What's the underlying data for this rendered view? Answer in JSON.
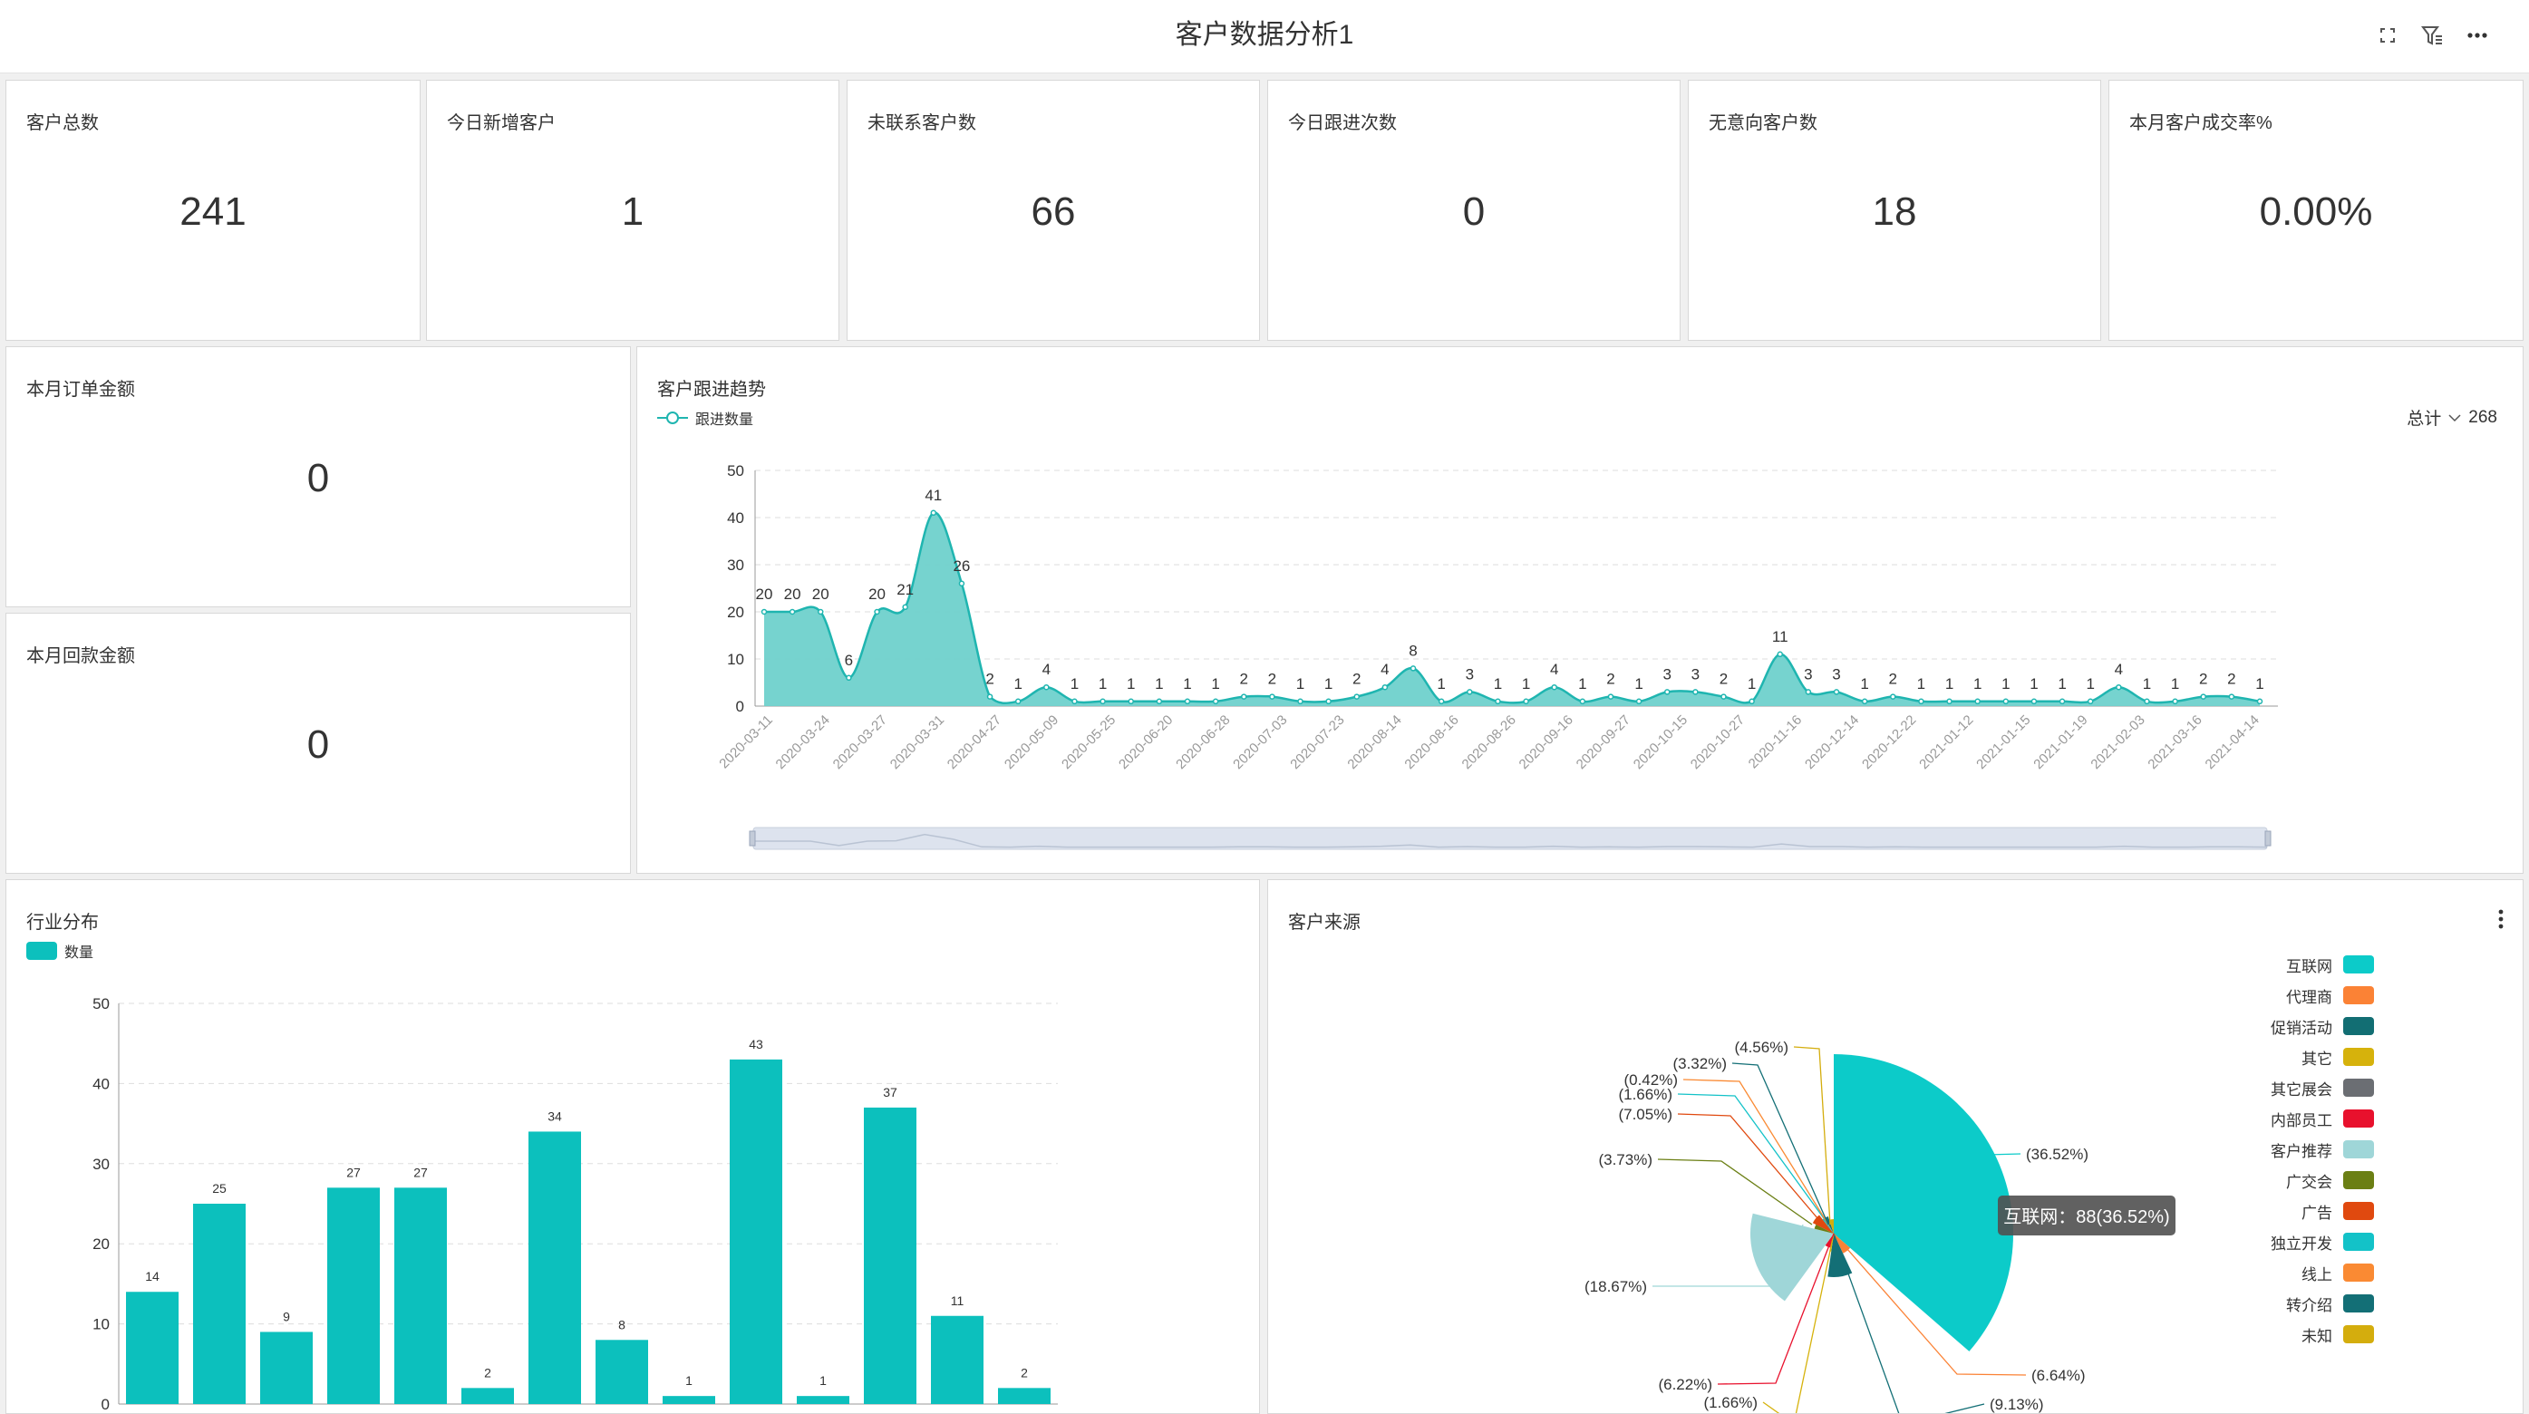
{
  "header": {
    "title": "客户数据分析1",
    "tools": [
      "expand-icon",
      "filter-icon",
      "more-icon"
    ]
  },
  "kpis": [
    {
      "label": "客户总数",
      "value": "241"
    },
    {
      "label": "今日新增客户",
      "value": "1"
    },
    {
      "label": "未联系客户数",
      "value": "66"
    },
    {
      "label": "今日跟进次数",
      "value": "0"
    },
    {
      "label": "无意向客户数",
      "value": "18"
    },
    {
      "label": "本月客户成交率%",
      "value": "0.00%"
    }
  ],
  "order_amount": {
    "label": "本月订单金额",
    "value": "0"
  },
  "payment_amount": {
    "label": "本月回款金额",
    "value": "0"
  },
  "trend": {
    "title": "客户跟进趋势",
    "legend": "跟进数量",
    "total_label": "总计",
    "total_value": "268"
  },
  "industry": {
    "title": "行业分布",
    "legend": "数量"
  },
  "source": {
    "title": "客户来源",
    "tooltip": "互联网：88(36.52%)"
  },
  "colors": {
    "teal": "#0cc0bd",
    "line": "#1fb5b0",
    "area": "#6fd1cc"
  },
  "chart_data": [
    {
      "type": "area",
      "title": "客户跟进趋势",
      "series": [
        {
          "name": "跟进数量",
          "values": [
            20,
            20,
            20,
            6,
            20,
            21,
            41,
            26,
            2,
            1,
            4,
            1,
            1,
            1,
            1,
            1,
            1,
            2,
            2,
            1,
            1,
            2,
            4,
            8,
            1,
            3,
            1,
            1,
            4,
            1,
            2,
            1,
            3,
            3,
            2,
            1,
            11,
            3,
            3,
            1,
            2,
            1,
            1,
            1,
            1,
            1,
            1,
            1,
            4,
            1,
            1,
            2,
            2,
            1
          ]
        }
      ],
      "x_tick_labels": [
        "2020-03-11",
        "2020-03-24",
        "2020-03-27",
        "2020-03-31",
        "2020-04-27",
        "2020-05-09",
        "2020-05-25",
        "2020-06-20",
        "2020-06-28",
        "2020-07-03",
        "2020-07-23",
        "2020-08-14",
        "2020-08-16",
        "2020-08-26",
        "2020-09-16",
        "2020-09-27",
        "2020-10-15",
        "2020-10-27",
        "2020-11-16",
        "2020-12-14",
        "2020-12-22",
        "2021-01-12",
        "2021-01-15",
        "2021-01-19",
        "2021-02-03",
        "2021-03-16",
        "2021-04-14"
      ],
      "ylim": [
        0,
        50
      ],
      "yticks": [
        0,
        10,
        20,
        30,
        40,
        50
      ],
      "grid": true,
      "legend": "top-left"
    },
    {
      "type": "bar",
      "title": "行业分布",
      "series": [
        {
          "name": "数量",
          "values": [
            14,
            25,
            9,
            27,
            27,
            2,
            34,
            8,
            1,
            43,
            1,
            37,
            11,
            2
          ]
        }
      ],
      "ylim": [
        0,
        50
      ],
      "yticks": [
        0,
        10,
        20,
        30,
        40,
        50
      ],
      "grid": true,
      "legend": "top-left"
    },
    {
      "type": "pie",
      "title": "客户来源",
      "rose": true,
      "categories": [
        "互联网",
        "代理商",
        "促销活动",
        "其它",
        "其它展会",
        "内部员工",
        "客户推荐",
        "广交会",
        "广告",
        "独立开发",
        "线上",
        "转介绍",
        "未知"
      ],
      "colors": [
        "#0ccbc9",
        "#fb8235",
        "#126e73",
        "#d6b20c",
        "#6b6e73",
        "#e8112d",
        "#9fd6d8",
        "#6b7f14",
        "#e0490f",
        "#13c2c8",
        "#fa8a33",
        "#136f76",
        "#d4ad0d"
      ],
      "visible_labels": [
        "(36.52%)",
        "(6.64%)",
        "(9.13%)",
        "(1.66%)",
        "(6.22%)",
        "(18.67%)",
        "(3.73%)",
        "(7.05%)",
        "(1.66%)",
        "(0.42%)",
        "(3.32%)",
        "(4.56%)"
      ],
      "legend": "right"
    }
  ]
}
